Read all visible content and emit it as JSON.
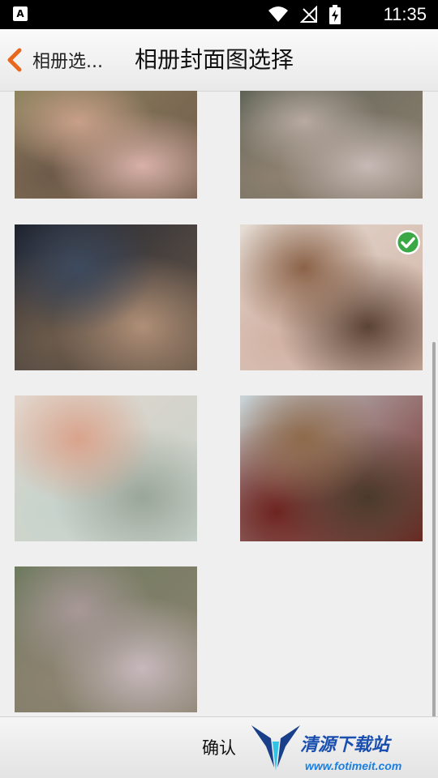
{
  "status_bar": {
    "time": "11:35",
    "left_icon": "A",
    "icons": [
      "wifi-icon",
      "signal-off-icon",
      "battery-charging-icon"
    ]
  },
  "header": {
    "back_label": "相册选...",
    "title": "相册封面图选择",
    "accent_color": "#e8671c"
  },
  "photos": [
    {
      "name": "photo-1",
      "selected": false,
      "colors": [
        "#8f8460",
        "#c9a08a",
        "#6f5a4a",
        "#d8b0a8"
      ]
    },
    {
      "name": "photo-2",
      "selected": false,
      "colors": [
        "#5f6356",
        "#b8aaa0",
        "#8d8070",
        "#c7b9b5"
      ]
    },
    {
      "name": "photo-3",
      "selected": false,
      "colors": [
        "#1e2330",
        "#3d4a5e",
        "#6b5a4a",
        "#b08f76"
      ]
    },
    {
      "name": "photo-4",
      "selected": true,
      "colors": [
        "#e5dcd4",
        "#8a6248",
        "#d2b3a5",
        "#5a4234"
      ]
    },
    {
      "name": "photo-5",
      "selected": false,
      "colors": [
        "#e3d6cc",
        "#d9a38c",
        "#c7d3cc",
        "#9aa69a"
      ]
    },
    {
      "name": "photo-6",
      "selected": false,
      "colors": [
        "#c9d4d8",
        "#8d6a4a",
        "#6e2520",
        "#4a3a2a"
      ]
    },
    {
      "name": "photo-7",
      "selected": false,
      "colors": [
        "#6e7a5e",
        "#a89898",
        "#8c8270",
        "#c7b8bc"
      ]
    }
  ],
  "bottom": {
    "confirm_label": "确认",
    "watermark_text": "清源下载站",
    "watermark_url": "www.fotimeit.com"
  }
}
